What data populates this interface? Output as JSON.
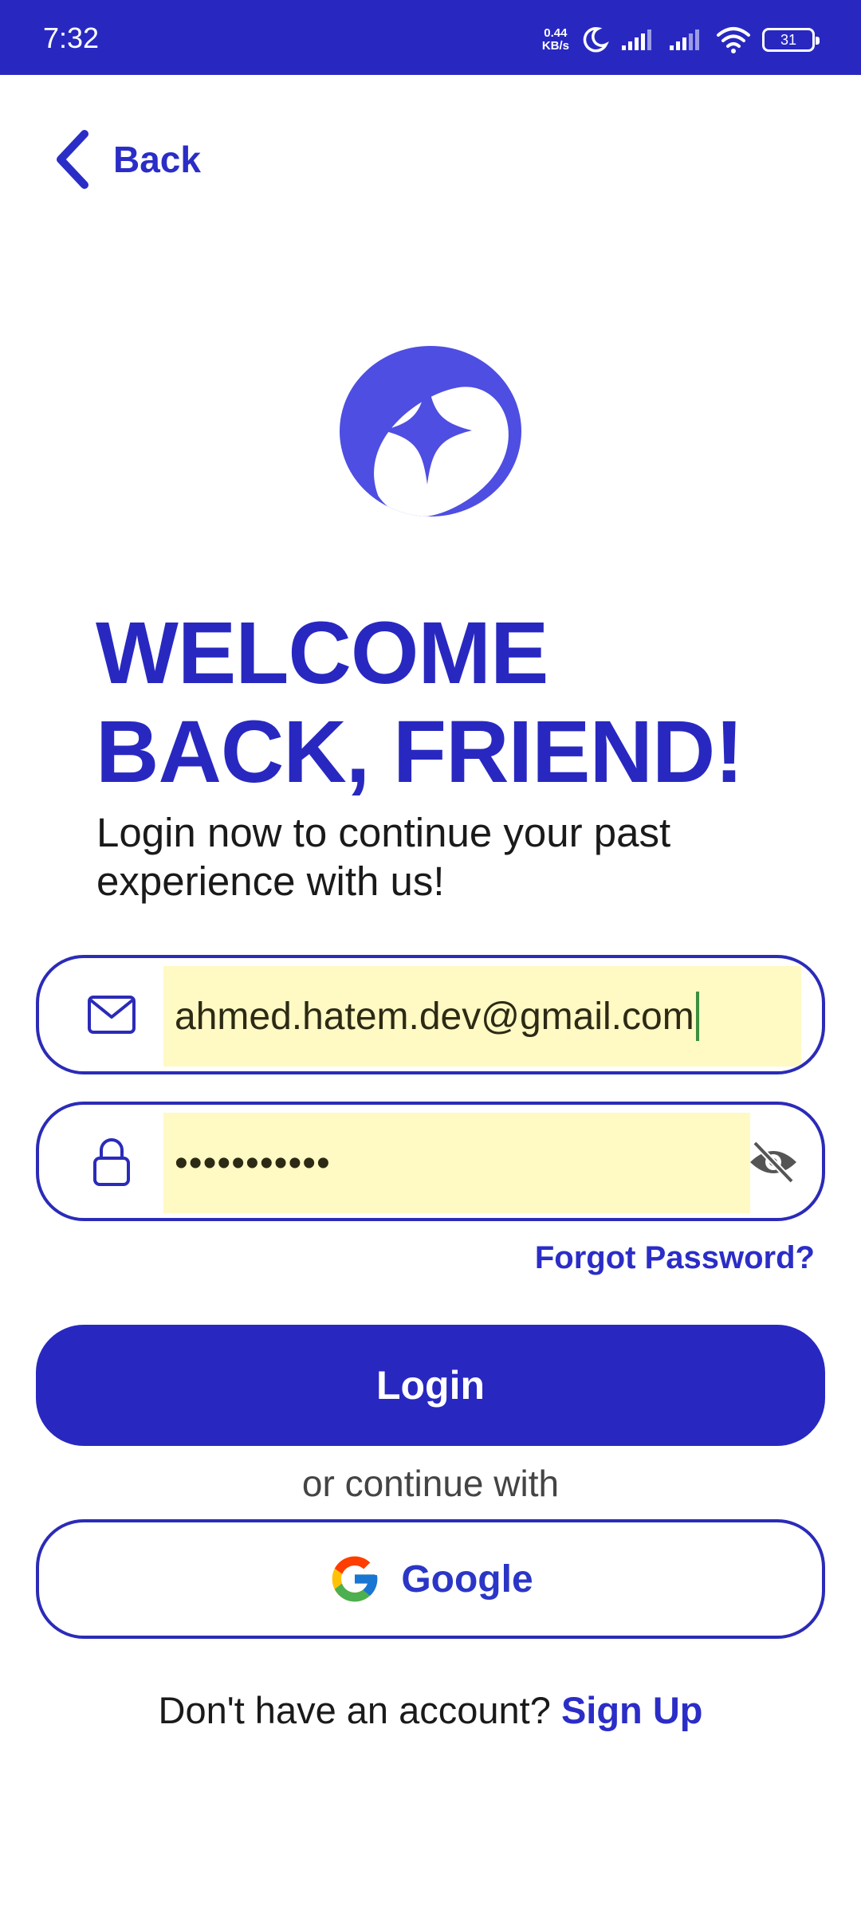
{
  "status_bar": {
    "time": "7:32",
    "net_speed_value": "0.44",
    "net_speed_unit": "KB/s",
    "battery": "31"
  },
  "nav": {
    "back_label": "Back"
  },
  "header": {
    "title_line1": "WELCOME",
    "title_line2": "BACK, FRIEND!",
    "subtitle": "Login now to continue your past experience with us!"
  },
  "form": {
    "email_value": "ahmed.hatem.dev@gmail.com",
    "password_value": "•••••••••••",
    "forgot_label": "Forgot Password?",
    "login_label": "Login"
  },
  "social": {
    "divider_text": "or continue with",
    "google_label": "Google"
  },
  "footer": {
    "prompt": "Don't have an account? ",
    "signup_label": "Sign Up"
  },
  "colors": {
    "primary": "#2828c1",
    "autofill_bg": "#fff9c4",
    "background": "#ffffff"
  },
  "icons": {
    "back": "chevron-left-icon",
    "logo": "sparkle-logo",
    "email": "envelope-icon",
    "password": "lock-icon",
    "visibility": "eye-off-icon",
    "google": "google-g-icon"
  }
}
